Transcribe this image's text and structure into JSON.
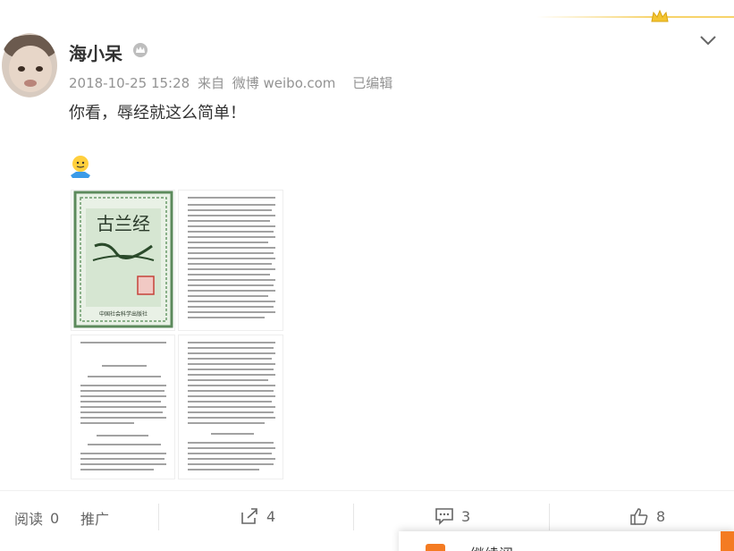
{
  "post": {
    "username": "海小呆",
    "date": "2018-10-25 15:28",
    "source_prefix": "来自",
    "source": "微博 weibo.com",
    "edited": "已编辑",
    "text": "你看，辱经就这么简单！"
  },
  "images": [
    {
      "name": "quran-cover"
    },
    {
      "name": "page-1"
    },
    {
      "name": "page-2"
    },
    {
      "name": "page-3"
    }
  ],
  "actions": {
    "read_label": "阅读",
    "read_count": "0",
    "promote_label": "推广",
    "share_count": "4",
    "comment_count": "3",
    "like_count": "8"
  },
  "popup": {
    "text": "继续阅…"
  },
  "colors": {
    "accent": "#f47b22",
    "crown": "#f7d36b",
    "meta": "#939393"
  }
}
